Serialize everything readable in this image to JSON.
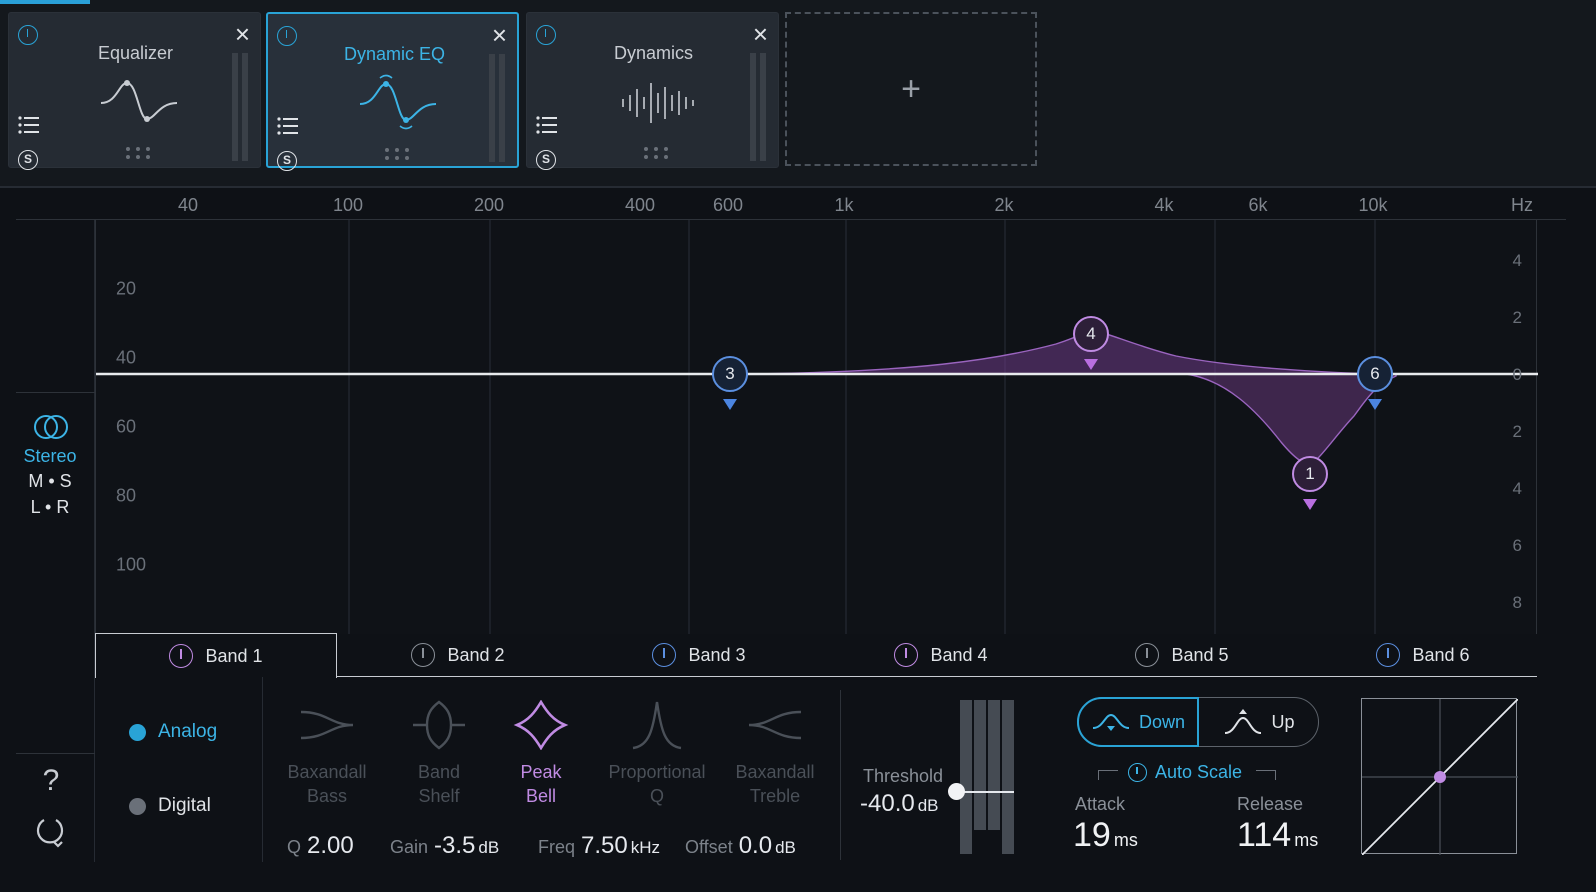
{
  "modules": [
    {
      "title": "Equalizer",
      "icon": "eq-curve-icon",
      "active": false
    },
    {
      "title": "Dynamic EQ",
      "icon": "dynamic-eq-curve-icon",
      "active": true
    },
    {
      "title": "Dynamics",
      "icon": "dynamics-waveform-icon",
      "active": false
    }
  ],
  "add_module_label": "+",
  "freq_axis": [
    "40",
    "100",
    "200",
    "400",
    "600",
    "1k",
    "2k",
    "4k",
    "6k",
    "10k",
    "Hz"
  ],
  "db_left": [
    "20",
    "40",
    "60",
    "80",
    "100"
  ],
  "db_right": [
    "4",
    "2",
    "0",
    "2",
    "4",
    "6",
    "8"
  ],
  "nodes": [
    {
      "label": "3",
      "color": "blue"
    },
    {
      "label": "4",
      "color": "pink"
    },
    {
      "label": "1",
      "color": "pink"
    },
    {
      "label": "6",
      "color": "blue"
    }
  ],
  "channel": {
    "stereo": "Stereo",
    "ms": "M • S",
    "lr": "L • R"
  },
  "help_label": "?",
  "bands": [
    {
      "label": "Band 1",
      "color": "pink",
      "active": true
    },
    {
      "label": "Band 2",
      "color": "gray",
      "active": false
    },
    {
      "label": "Band 3",
      "color": "blue",
      "active": false
    },
    {
      "label": "Band 4",
      "color": "pink",
      "active": false
    },
    {
      "label": "Band 5",
      "color": "gray",
      "active": false
    },
    {
      "label": "Band 6",
      "color": "blue",
      "active": false
    }
  ],
  "mode": {
    "analog": "Analog",
    "digital": "Digital",
    "selected": "Analog"
  },
  "shapes": [
    {
      "line1": "Baxandall",
      "line2": "Bass",
      "active": false
    },
    {
      "line1": "Band",
      "line2": "Shelf",
      "active": false
    },
    {
      "line1": "Peak",
      "line2": "Bell",
      "active": true
    },
    {
      "line1": "Proportional",
      "line2": "Q",
      "active": false
    },
    {
      "line1": "Baxandall",
      "line2": "Treble",
      "active": false
    }
  ],
  "params": {
    "q": {
      "label": "Q",
      "value": "2.00"
    },
    "gain": {
      "label": "Gain",
      "value": "-3.5",
      "unit": "dB"
    },
    "freq": {
      "label": "Freq",
      "value": "7.50",
      "unit": "kHz"
    },
    "offset": {
      "label": "Offset",
      "value": "0.0",
      "unit": "dB"
    }
  },
  "threshold": {
    "label": "Threshold",
    "value": "-40.0",
    "unit": "dB"
  },
  "direction": {
    "down": "Down",
    "up": "Up",
    "selected": "Down"
  },
  "auto_scale": "Auto Scale",
  "attack": {
    "label": "Attack",
    "value": "19",
    "unit": "ms"
  },
  "release": {
    "label": "Release",
    "value": "114",
    "unit": "ms"
  },
  "colors": {
    "accent": "#29a3d6",
    "pink": "#c08be3",
    "blue": "#5b8fe0"
  }
}
